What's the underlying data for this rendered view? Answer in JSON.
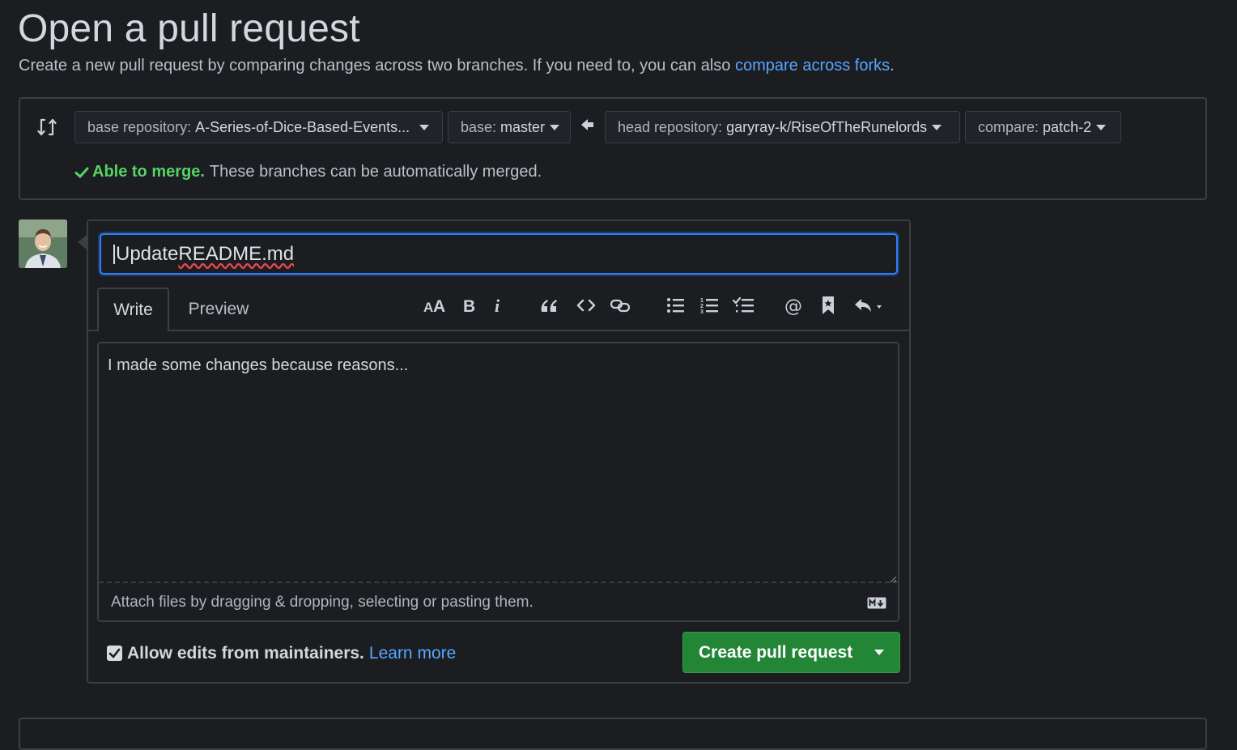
{
  "page": {
    "title": "Open a pull request",
    "subtitle_prefix": "Create a new pull request by comparing changes across two branches. If you need to, you can also ",
    "subtitle_link": "compare across forks",
    "subtitle_suffix": "."
  },
  "range": {
    "base_repo_label": "base repository:",
    "base_repo_value": "A-Series-of-Dice-Based-Events...",
    "base_label": "base:",
    "base_value": "master",
    "head_repo_label": "head repository:",
    "head_repo_value": "garyray-k/RiseOfTheRunelords",
    "compare_label": "compare:",
    "compare_value": "patch-2",
    "merge_status_strong": "Able to merge.",
    "merge_status_text": "These branches can be automatically merged."
  },
  "form": {
    "title_value_part1": "Update ",
    "title_value_part2": "README.md",
    "tabs": {
      "write": "Write",
      "preview": "Preview"
    },
    "toolbar_icons": [
      "text-size-icon",
      "bold-icon",
      "italic-icon",
      "quote-icon",
      "code-icon",
      "link-icon",
      "bullet-list-icon",
      "numbered-list-icon",
      "task-list-icon",
      "mention-icon",
      "reference-icon",
      "reply-icon"
    ],
    "body_text": "I made some changes because reasons...",
    "attach_hint": "Attach files by dragging & dropping, selecting or pasting them.",
    "allow_edits_label": "Allow edits from maintainers.",
    "learn_more": "Learn more",
    "allow_edits_checked": true,
    "submit_label": "Create pull request"
  },
  "colors": {
    "background": "#1b1d21",
    "link": "#58a6ff",
    "success": "#56d364",
    "primary_button": "#238636",
    "focus_ring": "#2f81f7"
  }
}
